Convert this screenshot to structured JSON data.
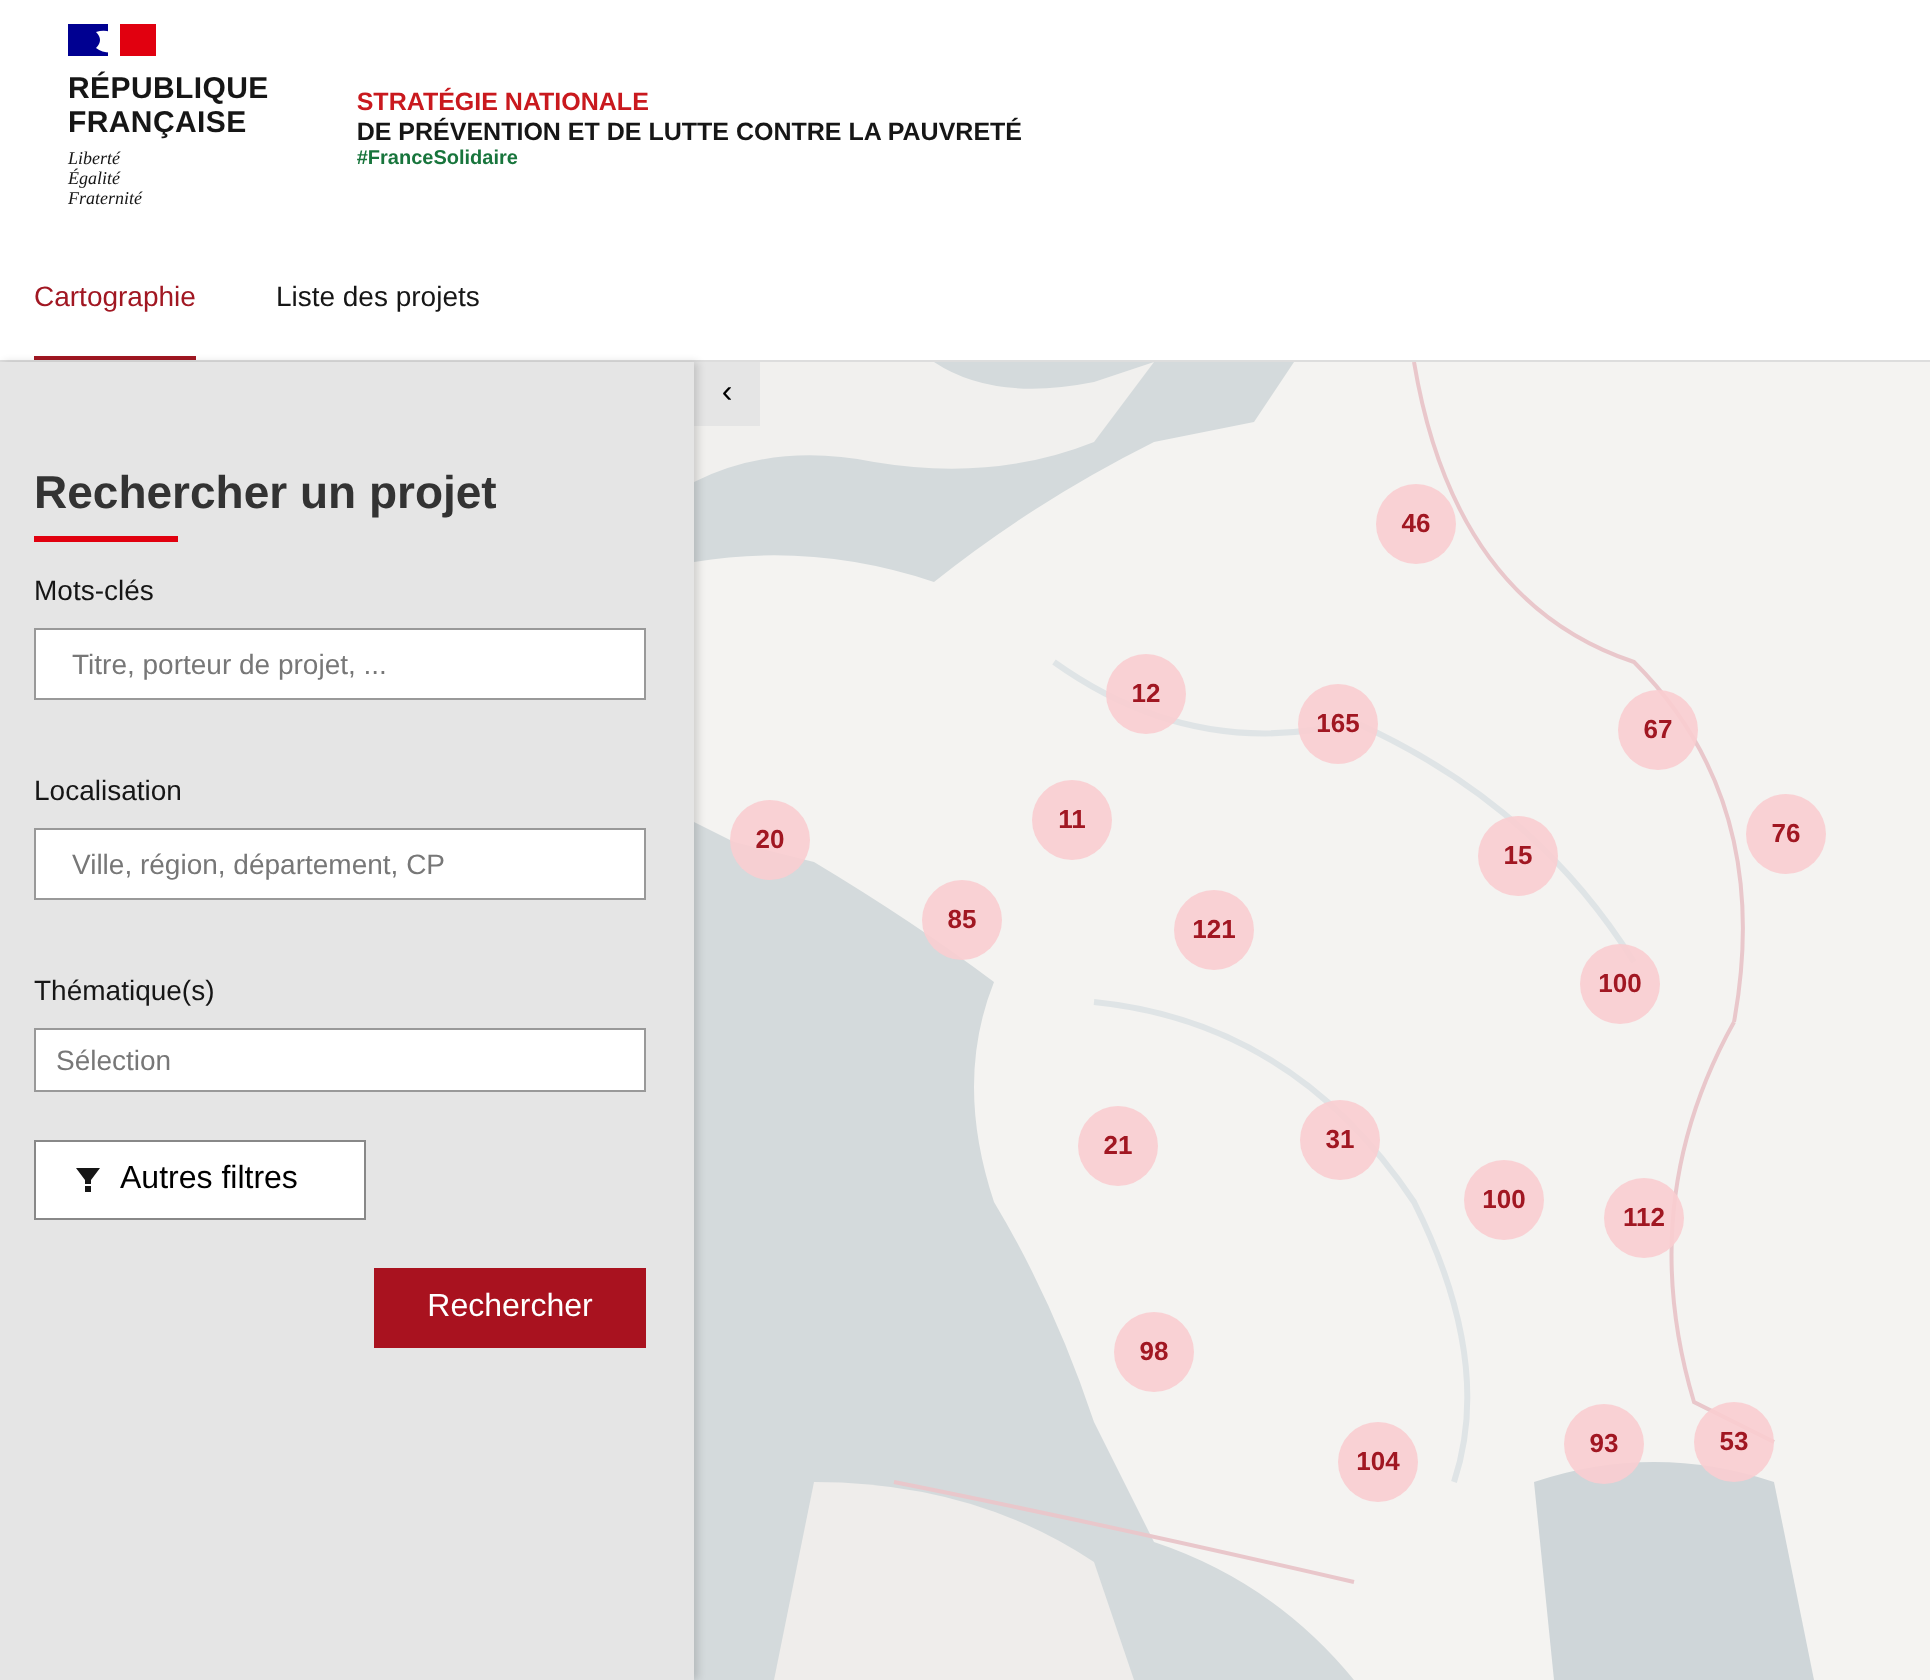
{
  "header": {
    "logo_lines": [
      "RÉPUBLIQUE",
      "FRANÇAISE"
    ],
    "motto": [
      "Liberté",
      "Égalité",
      "Fraternité"
    ],
    "title_lines": [
      "STRATÉGIE NATIONALE",
      "DE PRÉVENTION ET DE LUTTE CONTRE LA PAUVRETÉ"
    ],
    "hashtag": "#FranceSolidaire"
  },
  "tabs": [
    {
      "label": "Cartographie",
      "selected": true
    },
    {
      "label": "Liste des projets",
      "selected": false
    }
  ],
  "search_panel": {
    "title": "Rechercher un projet",
    "fields": [
      {
        "label": "Mots-clés",
        "placeholder": "Titre, porteur de projet, ...",
        "kind": "text"
      },
      {
        "label": "Localisation",
        "placeholder": "Ville, région, département, CP",
        "kind": "text"
      },
      {
        "label": "Thématique(s)",
        "placeholder": "Sélection",
        "kind": "select"
      }
    ],
    "filter_button": "Autres filtres",
    "submit_button": "Rechercher"
  },
  "map": {
    "collapse_button": "‹",
    "clusters": [
      {
        "count": "46"
      },
      {
        "count": "12"
      },
      {
        "count": "165"
      },
      {
        "count": "67"
      },
      {
        "count": "20"
      },
      {
        "count": "11"
      },
      {
        "count": "15"
      },
      {
        "count": "76"
      },
      {
        "count": "85"
      },
      {
        "count": "121"
      },
      {
        "count": "100"
      },
      {
        "count": "21"
      },
      {
        "count": "31"
      },
      {
        "count": "100"
      },
      {
        "count": "112"
      },
      {
        "count": "98"
      },
      {
        "count": "104"
      },
      {
        "count": "93"
      },
      {
        "count": "53"
      }
    ]
  }
}
